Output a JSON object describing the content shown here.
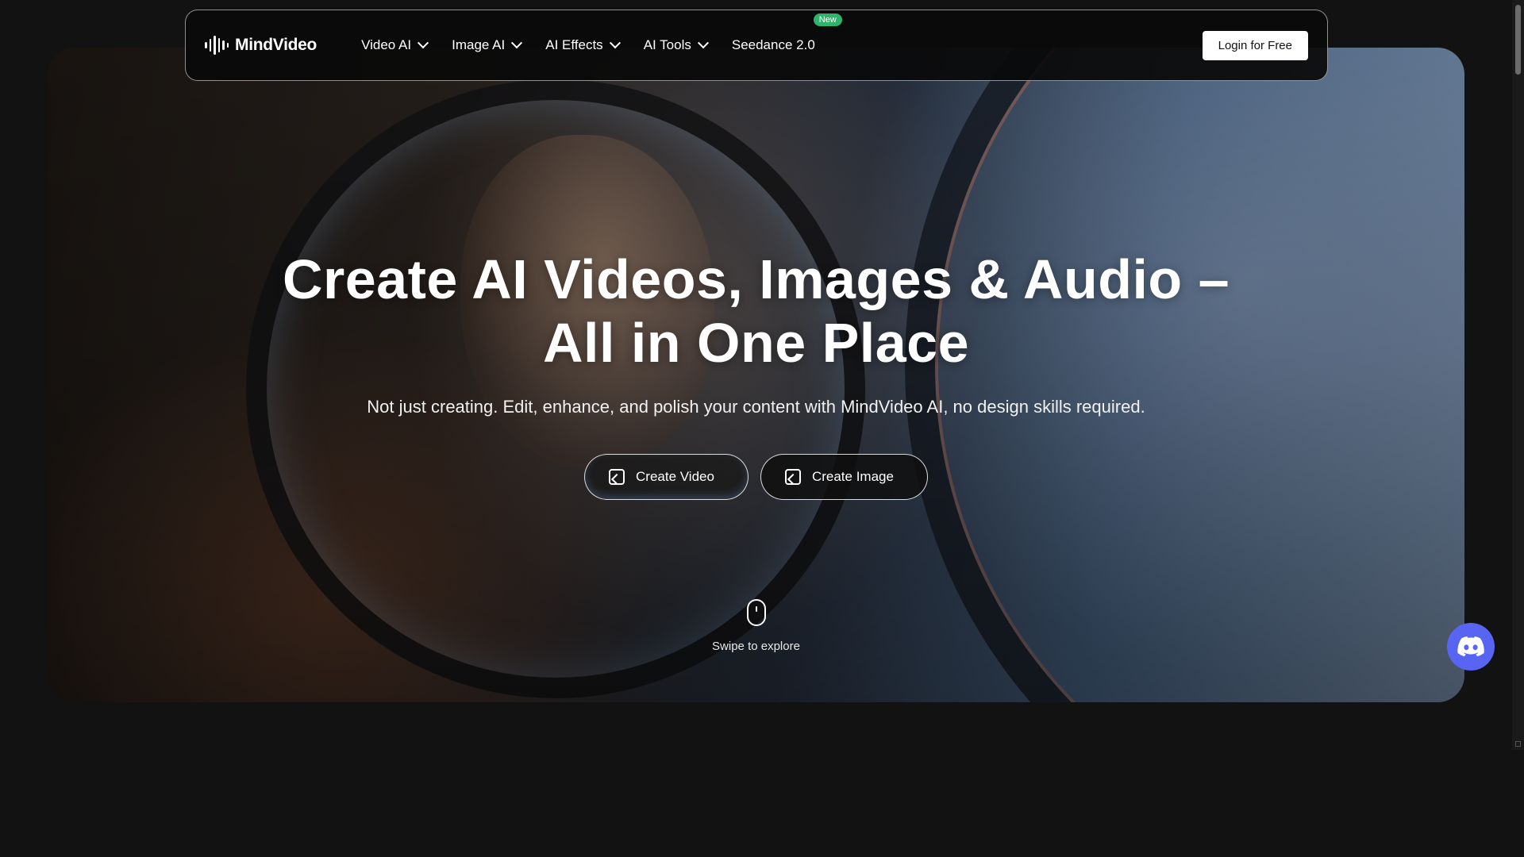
{
  "brand": {
    "name": "MindVideo"
  },
  "nav": {
    "items": [
      {
        "label": "Video AI",
        "has_dropdown": true
      },
      {
        "label": "Image AI",
        "has_dropdown": true
      },
      {
        "label": "AI Effects",
        "has_dropdown": true
      },
      {
        "label": "AI Tools",
        "has_dropdown": true
      },
      {
        "label": "Seedance 2.0",
        "has_dropdown": false,
        "badge": "New"
      }
    ],
    "login_label": "Login for Free"
  },
  "hero": {
    "headline_line1": "Create AI Videos, Images & Audio –",
    "headline_line2": "All in One Place",
    "subheadline": "Not just creating. Edit, enhance, and polish your content with MindVideo AI, no design skills required.",
    "cta_video": "Create Video",
    "cta_image": "Create Image",
    "scroll_hint": "Swipe to explore"
  },
  "colors": {
    "page_bg": "#121212",
    "badge_green": "#2fb36b",
    "discord_blue": "#5865f2",
    "login_bg": "#ffffff"
  },
  "icons": {
    "logo": "soundwave-logo-icon",
    "dropdown": "chevron-down-icon",
    "create_video": "video-frame-icon",
    "create_image": "image-frame-icon",
    "scroll": "mouse-scroll-icon",
    "discord": "discord-icon"
  }
}
